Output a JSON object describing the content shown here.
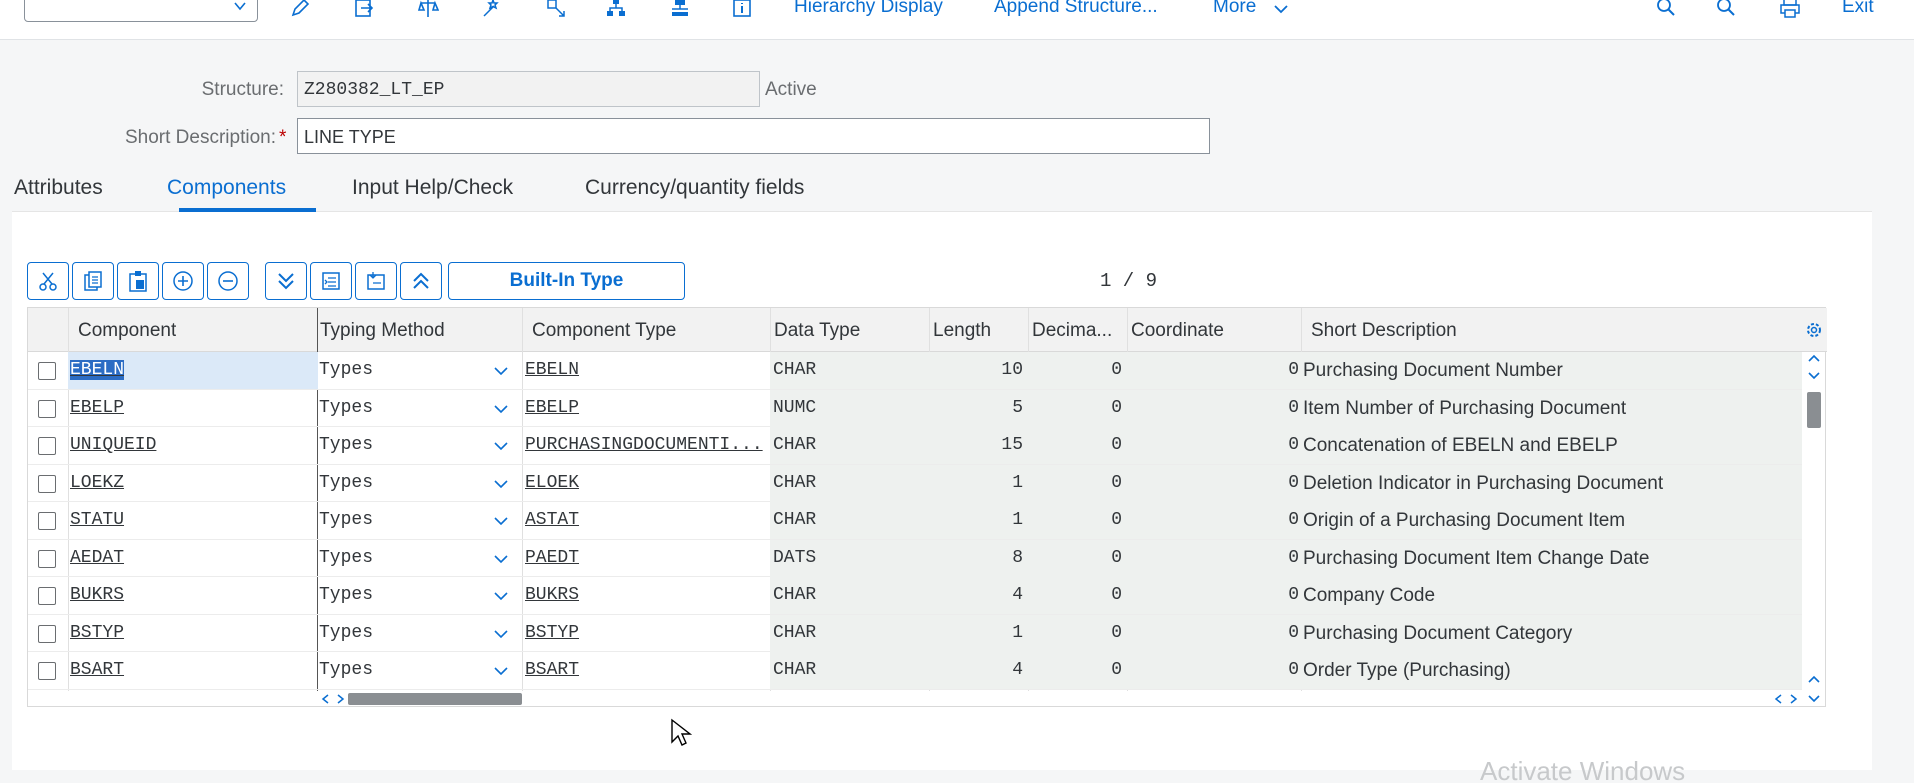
{
  "toolbar": {
    "links": [
      "Hierarchy Display",
      "Append Structure...",
      "More"
    ],
    "exit_label": "Exit"
  },
  "header": {
    "structure_label": "Structure:",
    "structure_value": "Z280382_LT_EP",
    "status": "Active",
    "short_desc_label": "Short Description:",
    "required_mark": "*",
    "short_desc_value": "LINE TYPE"
  },
  "tabs": [
    {
      "label": "Attributes",
      "active": false
    },
    {
      "label": "Components",
      "active": true
    },
    {
      "label": "Input Help/Check",
      "active": false
    },
    {
      "label": "Currency/quantity fields",
      "active": false
    }
  ],
  "table_toolbar": {
    "builtin_label": "Built-In Type",
    "pager": "1 / 9"
  },
  "table": {
    "columns": [
      "Component",
      "Typing Method",
      "Component Type",
      "Data Type",
      "Length",
      "Decima...",
      "Coordinate",
      "Short Description"
    ],
    "rows": [
      {
        "component": "EBELN",
        "typing": "Types",
        "ctype": "EBELN",
        "dtype": "CHAR",
        "length": "10",
        "decimals": "0",
        "coord": "0",
        "desc": "Purchasing Document Number"
      },
      {
        "component": "EBELP",
        "typing": "Types",
        "ctype": "EBELP",
        "dtype": "NUMC",
        "length": "5",
        "decimals": "0",
        "coord": "0",
        "desc": "Item Number of Purchasing Document"
      },
      {
        "component": "UNIQUEID",
        "typing": "Types",
        "ctype": "PURCHASINGDOCUMENTI...",
        "dtype": "CHAR",
        "length": "15",
        "decimals": "0",
        "coord": "0",
        "desc": "Concatenation of EBELN and EBELP"
      },
      {
        "component": "LOEKZ",
        "typing": "Types",
        "ctype": "ELOEK",
        "dtype": "CHAR",
        "length": "1",
        "decimals": "0",
        "coord": "0",
        "desc": "Deletion Indicator in Purchasing Document"
      },
      {
        "component": "STATU",
        "typing": "Types",
        "ctype": "ASTAT",
        "dtype": "CHAR",
        "length": "1",
        "decimals": "0",
        "coord": "0",
        "desc": "Origin of a Purchasing Document Item"
      },
      {
        "component": "AEDAT",
        "typing": "Types",
        "ctype": "PAEDT",
        "dtype": "DATS",
        "length": "8",
        "decimals": "0",
        "coord": "0",
        "desc": "Purchasing Document Item Change Date"
      },
      {
        "component": "BUKRS",
        "typing": "Types",
        "ctype": "BUKRS",
        "dtype": "CHAR",
        "length": "4",
        "decimals": "0",
        "coord": "0",
        "desc": "Company Code"
      },
      {
        "component": "BSTYP",
        "typing": "Types",
        "ctype": "BSTYP",
        "dtype": "CHAR",
        "length": "1",
        "decimals": "0",
        "coord": "0",
        "desc": "Purchasing Document Category"
      },
      {
        "component": "BSART",
        "typing": "Types",
        "ctype": "BSART",
        "dtype": "CHAR",
        "length": "4",
        "decimals": "0",
        "coord": "0",
        "desc": "Order Type (Purchasing)"
      }
    ]
  },
  "watermark": "Activate Windows"
}
